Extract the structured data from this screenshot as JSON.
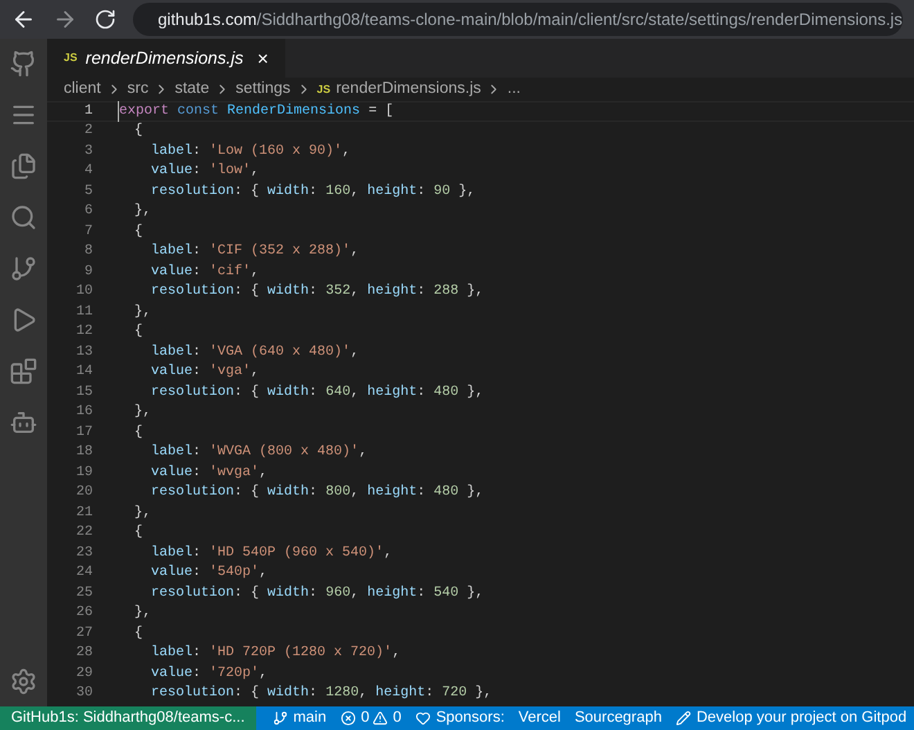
{
  "browser": {
    "url_host": "github1s.com",
    "url_path": "/Siddharthg08/teams-clone-main/blob/main/client/src/state/settings/renderDimensions.js"
  },
  "activity_bar": [
    {
      "kind": "github"
    },
    {
      "kind": "menu"
    },
    {
      "kind": "files"
    },
    {
      "kind": "search"
    },
    {
      "kind": "source-control"
    },
    {
      "kind": "run"
    },
    {
      "kind": "extensions"
    },
    {
      "kind": "remote"
    }
  ],
  "tab": {
    "badge": "JS",
    "title": "renderDimensions.js",
    "close": "×",
    "selected": true
  },
  "breadcrumbs": [
    {
      "text": "client"
    },
    {
      "text": "src"
    },
    {
      "text": "state"
    },
    {
      "text": "settings"
    },
    {
      "badge": "JS",
      "text": "renderDimensions.js"
    },
    {
      "text": "..."
    }
  ],
  "lines": [
    {
      "number": "1",
      "tokens": [
        {
          "kind": "keyword",
          "text": "export"
        },
        {
          "kind": "storage",
          "text": " const"
        },
        {
          "kind": "constant",
          "text": " RenderDimensions"
        },
        {
          "kind": "punct",
          "text": " = ["
        }
      ]
    },
    {
      "number": "2",
      "tokens": [
        {
          "kind": "punct",
          "text": "  {"
        }
      ]
    },
    {
      "number": "3",
      "tokens": [
        {
          "kind": "prop",
          "text": "    label"
        },
        {
          "kind": "punct",
          "text": ": "
        },
        {
          "kind": "string",
          "text": "'Low (160 x 90)'"
        },
        {
          "kind": "punct",
          "text": ","
        }
      ]
    },
    {
      "number": "4",
      "tokens": [
        {
          "kind": "prop",
          "text": "    value"
        },
        {
          "kind": "punct",
          "text": ": "
        },
        {
          "kind": "string",
          "text": "'low'"
        },
        {
          "kind": "punct",
          "text": ","
        }
      ]
    },
    {
      "number": "5",
      "tokens": [
        {
          "kind": "prop",
          "text": "    resolution"
        },
        {
          "kind": "punct",
          "text": ": { "
        },
        {
          "kind": "prop",
          "text": "width"
        },
        {
          "kind": "punct",
          "text": ": "
        },
        {
          "kind": "number",
          "text": "160"
        },
        {
          "kind": "punct",
          "text": ", "
        },
        {
          "kind": "prop",
          "text": "height"
        },
        {
          "kind": "punct",
          "text": ": "
        },
        {
          "kind": "number",
          "text": "90"
        },
        {
          "kind": "punct",
          "text": " },"
        }
      ]
    },
    {
      "number": "6",
      "tokens": [
        {
          "kind": "punct",
          "text": "  },"
        }
      ]
    },
    {
      "number": "7",
      "tokens": [
        {
          "kind": "punct",
          "text": "  {"
        }
      ]
    },
    {
      "number": "8",
      "tokens": [
        {
          "kind": "prop",
          "text": "    label"
        },
        {
          "kind": "punct",
          "text": ": "
        },
        {
          "kind": "string",
          "text": "'CIF (352 x 288)'"
        },
        {
          "kind": "punct",
          "text": ","
        }
      ]
    },
    {
      "number": "9",
      "tokens": [
        {
          "kind": "prop",
          "text": "    value"
        },
        {
          "kind": "punct",
          "text": ": "
        },
        {
          "kind": "string",
          "text": "'cif'"
        },
        {
          "kind": "punct",
          "text": ","
        }
      ]
    },
    {
      "number": "10",
      "tokens": [
        {
          "kind": "prop",
          "text": "    resolution"
        },
        {
          "kind": "punct",
          "text": ": { "
        },
        {
          "kind": "prop",
          "text": "width"
        },
        {
          "kind": "punct",
          "text": ": "
        },
        {
          "kind": "number",
          "text": "352"
        },
        {
          "kind": "punct",
          "text": ", "
        },
        {
          "kind": "prop",
          "text": "height"
        },
        {
          "kind": "punct",
          "text": ": "
        },
        {
          "kind": "number",
          "text": "288"
        },
        {
          "kind": "punct",
          "text": " },"
        }
      ]
    },
    {
      "number": "11",
      "tokens": [
        {
          "kind": "punct",
          "text": "  },"
        }
      ]
    },
    {
      "number": "12",
      "tokens": [
        {
          "kind": "punct",
          "text": "  {"
        }
      ]
    },
    {
      "number": "13",
      "tokens": [
        {
          "kind": "prop",
          "text": "    label"
        },
        {
          "kind": "punct",
          "text": ": "
        },
        {
          "kind": "string",
          "text": "'VGA (640 x 480)'"
        },
        {
          "kind": "punct",
          "text": ","
        }
      ]
    },
    {
      "number": "14",
      "tokens": [
        {
          "kind": "prop",
          "text": "    value"
        },
        {
          "kind": "punct",
          "text": ": "
        },
        {
          "kind": "string",
          "text": "'vga'"
        },
        {
          "kind": "punct",
          "text": ","
        }
      ]
    },
    {
      "number": "15",
      "tokens": [
        {
          "kind": "prop",
          "text": "    resolution"
        },
        {
          "kind": "punct",
          "text": ": { "
        },
        {
          "kind": "prop",
          "text": "width"
        },
        {
          "kind": "punct",
          "text": ": "
        },
        {
          "kind": "number",
          "text": "640"
        },
        {
          "kind": "punct",
          "text": ", "
        },
        {
          "kind": "prop",
          "text": "height"
        },
        {
          "kind": "punct",
          "text": ": "
        },
        {
          "kind": "number",
          "text": "480"
        },
        {
          "kind": "punct",
          "text": " },"
        }
      ]
    },
    {
      "number": "16",
      "tokens": [
        {
          "kind": "punct",
          "text": "  },"
        }
      ]
    },
    {
      "number": "17",
      "tokens": [
        {
          "kind": "punct",
          "text": "  {"
        }
      ]
    },
    {
      "number": "18",
      "tokens": [
        {
          "kind": "prop",
          "text": "    label"
        },
        {
          "kind": "punct",
          "text": ": "
        },
        {
          "kind": "string",
          "text": "'WVGA (800 x 480)'"
        },
        {
          "kind": "punct",
          "text": ","
        }
      ]
    },
    {
      "number": "19",
      "tokens": [
        {
          "kind": "prop",
          "text": "    value"
        },
        {
          "kind": "punct",
          "text": ": "
        },
        {
          "kind": "string",
          "text": "'wvga'"
        },
        {
          "kind": "punct",
          "text": ","
        }
      ]
    },
    {
      "number": "20",
      "tokens": [
        {
          "kind": "prop",
          "text": "    resolution"
        },
        {
          "kind": "punct",
          "text": ": { "
        },
        {
          "kind": "prop",
          "text": "width"
        },
        {
          "kind": "punct",
          "text": ": "
        },
        {
          "kind": "number",
          "text": "800"
        },
        {
          "kind": "punct",
          "text": ", "
        },
        {
          "kind": "prop",
          "text": "height"
        },
        {
          "kind": "punct",
          "text": ": "
        },
        {
          "kind": "number",
          "text": "480"
        },
        {
          "kind": "punct",
          "text": " },"
        }
      ]
    },
    {
      "number": "21",
      "tokens": [
        {
          "kind": "punct",
          "text": "  },"
        }
      ]
    },
    {
      "number": "22",
      "tokens": [
        {
          "kind": "punct",
          "text": "  {"
        }
      ]
    },
    {
      "number": "23",
      "tokens": [
        {
          "kind": "prop",
          "text": "    label"
        },
        {
          "kind": "punct",
          "text": ": "
        },
        {
          "kind": "string",
          "text": "'HD 540P (960 x 540)'"
        },
        {
          "kind": "punct",
          "text": ","
        }
      ]
    },
    {
      "number": "24",
      "tokens": [
        {
          "kind": "prop",
          "text": "    value"
        },
        {
          "kind": "punct",
          "text": ": "
        },
        {
          "kind": "string",
          "text": "'540p'"
        },
        {
          "kind": "punct",
          "text": ","
        }
      ]
    },
    {
      "number": "25",
      "tokens": [
        {
          "kind": "prop",
          "text": "    resolution"
        },
        {
          "kind": "punct",
          "text": ": { "
        },
        {
          "kind": "prop",
          "text": "width"
        },
        {
          "kind": "punct",
          "text": ": "
        },
        {
          "kind": "number",
          "text": "960"
        },
        {
          "kind": "punct",
          "text": ", "
        },
        {
          "kind": "prop",
          "text": "height"
        },
        {
          "kind": "punct",
          "text": ": "
        },
        {
          "kind": "number",
          "text": "540"
        },
        {
          "kind": "punct",
          "text": " },"
        }
      ]
    },
    {
      "number": "26",
      "tokens": [
        {
          "kind": "punct",
          "text": "  },"
        }
      ]
    },
    {
      "number": "27",
      "tokens": [
        {
          "kind": "punct",
          "text": "  {"
        }
      ]
    },
    {
      "number": "28",
      "tokens": [
        {
          "kind": "prop",
          "text": "    label"
        },
        {
          "kind": "punct",
          "text": ": "
        },
        {
          "kind": "string",
          "text": "'HD 720P (1280 x 720)'"
        },
        {
          "kind": "punct",
          "text": ","
        }
      ]
    },
    {
      "number": "29",
      "tokens": [
        {
          "kind": "prop",
          "text": "    value"
        },
        {
          "kind": "punct",
          "text": ": "
        },
        {
          "kind": "string",
          "text": "'720p'"
        },
        {
          "kind": "punct",
          "text": ","
        }
      ]
    },
    {
      "number": "30",
      "tokens": [
        {
          "kind": "prop",
          "text": "    resolution"
        },
        {
          "kind": "punct",
          "text": ": { "
        },
        {
          "kind": "prop",
          "text": "width"
        },
        {
          "kind": "punct",
          "text": ": "
        },
        {
          "kind": "number",
          "text": "1280"
        },
        {
          "kind": "punct",
          "text": ", "
        },
        {
          "kind": "prop",
          "text": "height"
        },
        {
          "kind": "punct",
          "text": ": "
        },
        {
          "kind": "number",
          "text": "720"
        },
        {
          "kind": "punct",
          "text": " },"
        }
      ]
    }
  ],
  "status_bar": {
    "remote": "GitHub1s: Siddharthg08/teams-c...",
    "items": [
      {
        "kind": "branch",
        "text": "main"
      },
      {
        "kind": "errors",
        "text": "0"
      },
      {
        "kind": "warnings",
        "text": "0"
      },
      {
        "kind": "sponsors",
        "text": "Sponsors:"
      },
      {
        "kind": "plain",
        "text": "Vercel"
      },
      {
        "kind": "plain",
        "text": "Sourcegraph"
      },
      {
        "kind": "edit",
        "text": "Develop your project on Gitpod"
      }
    ]
  }
}
